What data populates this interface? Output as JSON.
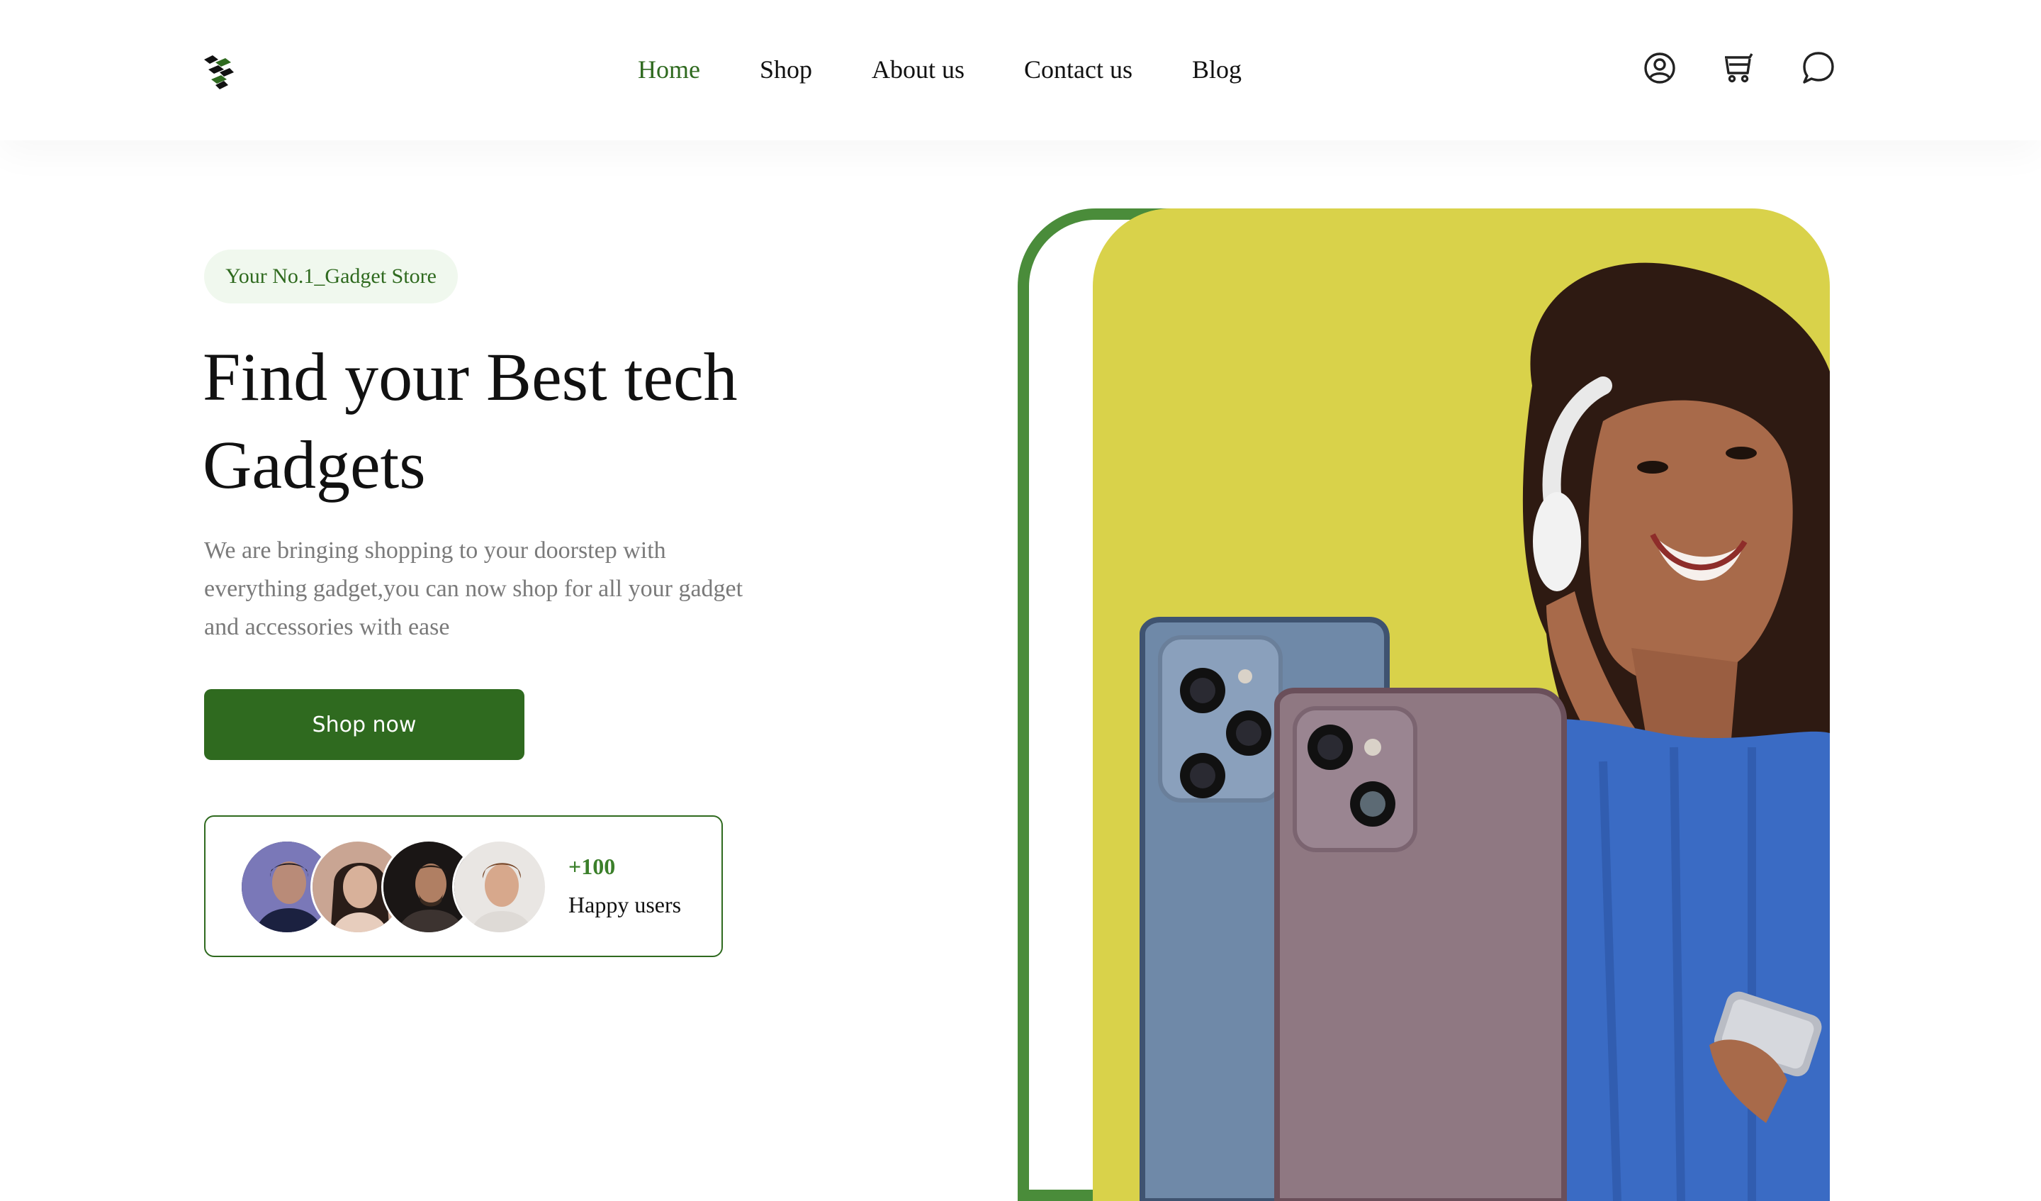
{
  "brand": {
    "logo_icon": "logo-icon",
    "accent_color": "#2f6a1f",
    "yellow": "#d9d24a"
  },
  "nav": {
    "items": [
      {
        "label": "Home",
        "active": true
      },
      {
        "label": "Shop",
        "active": false
      },
      {
        "label": "About us",
        "active": false
      },
      {
        "label": "Contact us",
        "active": false
      },
      {
        "label": "Blog",
        "active": false
      }
    ]
  },
  "header_icons": [
    "user-icon",
    "cart-icon",
    "chat-icon"
  ],
  "hero": {
    "badge": "Your No.1_Gadget Store",
    "title_line1": "Find your Best tech",
    "title_line2": "Gadgets",
    "description_line1": "We are bringing shopping to your doorstep with",
    "description_line2": "everything gadget,you can now shop for all your gadget",
    "description_line3": "and accessories with ease",
    "cta_label": "Shop now",
    "users": {
      "count": "+100",
      "label": "Happy users"
    }
  }
}
